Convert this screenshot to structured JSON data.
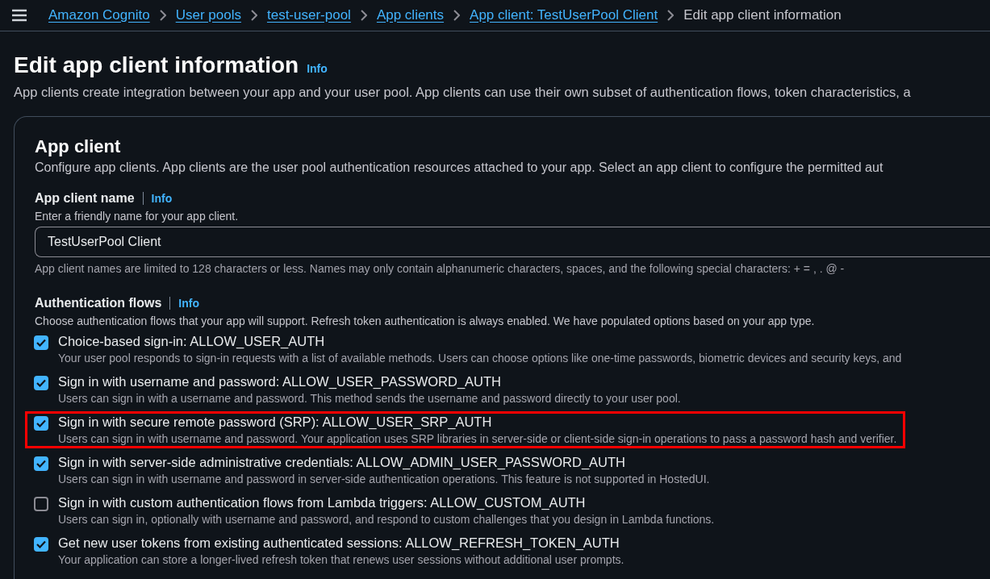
{
  "breadcrumbs": [
    {
      "label": "Amazon Cognito",
      "link": true
    },
    {
      "label": "User pools",
      "link": true
    },
    {
      "label": "test-user-pool",
      "link": true
    },
    {
      "label": "App clients",
      "link": true
    },
    {
      "label": "App client: TestUserPool Client",
      "link": true
    },
    {
      "label": "Edit app client information",
      "link": false
    }
  ],
  "page": {
    "title": "Edit app client information",
    "info": "Info",
    "description": "App clients create integration between your app and your user pool. App clients can use their own subset of authentication flows, token characteristics, a"
  },
  "card": {
    "title": "App client",
    "description": "Configure app clients. App clients are the user pool authentication resources attached to your app. Select an app client to configure the permitted aut",
    "name_field": {
      "label": "App client name",
      "info": "Info",
      "hint": "Enter a friendly name for your app client.",
      "value": "TestUserPool Client",
      "constraint": "App client names are limited to 128 characters or less. Names may only contain alphanumeric characters, spaces, and the following special characters: + = , . @ -"
    },
    "auth_flows": {
      "label": "Authentication flows",
      "info": "Info",
      "hint": "Choose authentication flows that your app will support. Refresh token authentication is always enabled. We have populated options based on your app type.",
      "options": [
        {
          "label": "Choice-based sign-in: ALLOW_USER_AUTH",
          "description": "Your user pool responds to sign-in requests with a list of available methods. Users can choose options like one-time passwords, biometric devices and security keys, and",
          "checked": true,
          "highlighted": false
        },
        {
          "label": "Sign in with username and password: ALLOW_USER_PASSWORD_AUTH",
          "description": "Users can sign in with a username and password. This method sends the username and password directly to your user pool.",
          "checked": true,
          "highlighted": false
        },
        {
          "label": "Sign in with secure remote password (SRP): ALLOW_USER_SRP_AUTH",
          "description": "Users can sign in with username and password. Your application uses SRP libraries in server-side or client-side sign-in operations to pass a password hash and verifier.",
          "checked": true,
          "highlighted": true
        },
        {
          "label": "Sign in with server-side administrative credentials: ALLOW_ADMIN_USER_PASSWORD_AUTH",
          "description": "Users can sign in with username and password in server-side authentication operations. This feature is not supported in HostedUI.",
          "checked": true,
          "highlighted": false
        },
        {
          "label": "Sign in with custom authentication flows from Lambda triggers: ALLOW_CUSTOM_AUTH",
          "description": "Users can sign in, optionally with username and password, and respond to custom challenges that you design in Lambda functions.",
          "checked": false,
          "highlighted": false
        },
        {
          "label": "Get new user tokens from existing authenticated sessions: ALLOW_REFRESH_TOKEN_AUTH",
          "description": "Your application can store a longer-lived refresh token that renews user sessions without additional user prompts.",
          "checked": true,
          "highlighted": false
        }
      ]
    }
  }
}
